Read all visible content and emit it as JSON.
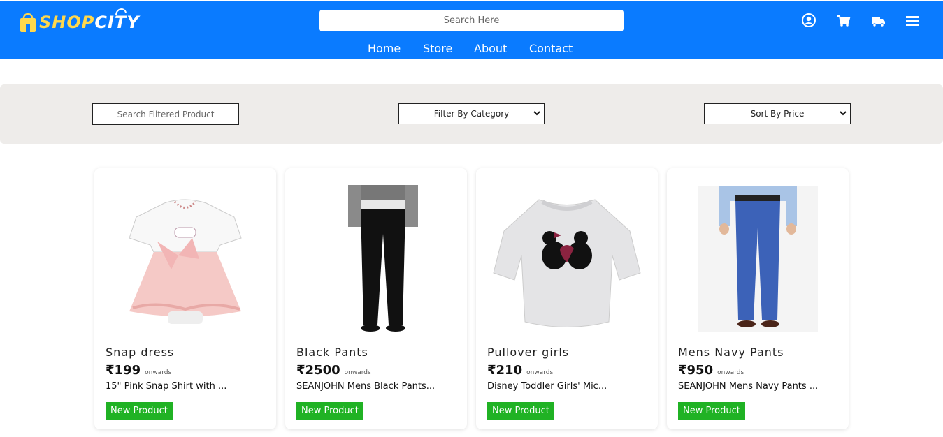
{
  "header": {
    "logo": {
      "part1": "SHOP",
      "part2": "CITY"
    },
    "search_placeholder": "Search Here",
    "nav": [
      "Home",
      "Store",
      "About",
      "Contact"
    ],
    "icons": [
      "user-icon",
      "cart-icon",
      "truck-icon",
      "menu-icon"
    ],
    "brand_color": "#0a7bff",
    "logo_accent": "#ffd84d"
  },
  "filters": {
    "search_placeholder": "Search Filtered Product",
    "category_label": "Filter By Category",
    "sort_label": "Sort By Price"
  },
  "products": [
    {
      "title": "Snap dress",
      "price": "₹199",
      "onwards": "onwards",
      "desc": "15\" Pink Snap Shirt with ...",
      "badge": "New Product",
      "image": "pink-snap-dress"
    },
    {
      "title": "Black Pants",
      "price": "₹2500",
      "onwards": "onwards",
      "desc": "SEANJOHN Mens Black Pants...",
      "badge": "New Product",
      "image": "black-pants"
    },
    {
      "title": "Pullover girls",
      "price": "₹210",
      "onwards": "onwards",
      "desc": "Disney Toddler Girls' Mic...",
      "badge": "New Product",
      "image": "grey-pullover"
    },
    {
      "title": "Mens Navy Pants",
      "price": "₹950",
      "onwards": "onwards",
      "desc": "SEANJOHN Mens Navy Pants ...",
      "badge": "New Product",
      "image": "navy-pants"
    }
  ],
  "badge_color": "#20b224"
}
